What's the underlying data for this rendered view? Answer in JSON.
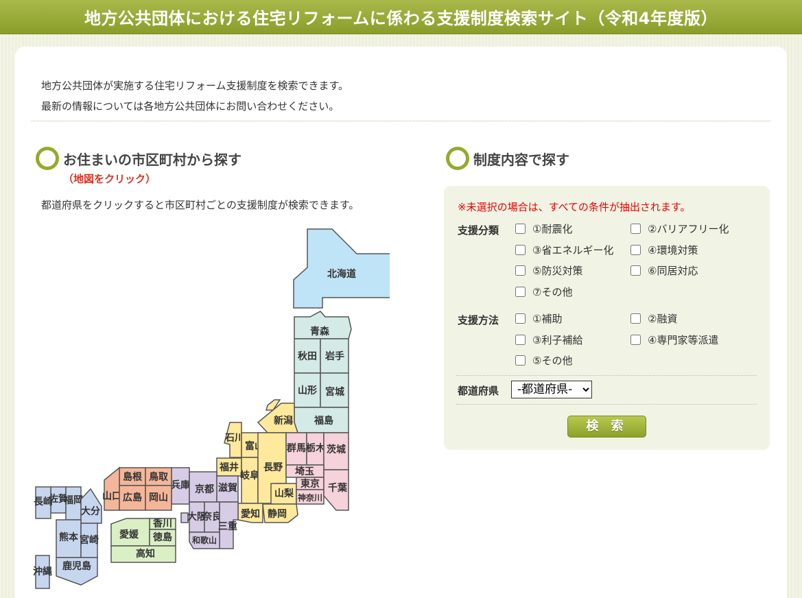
{
  "header": {
    "title": "地方公共団体における住宅リフォームに係わる支援制度検索サイト（令和4年度版）"
  },
  "intro": {
    "line1": "地方公共団体が実施する住宅リフォーム支援制度を検索できます。",
    "line2": "最新の情報については各地方公共団体にお問い合わせください。"
  },
  "map_section": {
    "title": "お住まいの市区町村から探す",
    "subtitle": "（地図をクリック）",
    "description": "都道府県をクリックすると市区町村ごとの支援制度が検索できます。"
  },
  "colors": {
    "hokkaido": "#bfe3f7",
    "tohoku": "#d3eae6",
    "kanto": "#f6d2da",
    "chubu": "#ffe99c",
    "kinki": "#d7cce6",
    "chugoku": "#f4b699",
    "shikoku": "#dbefc5",
    "kyushu": "#c7d6ef"
  },
  "prefectures": {
    "hokkaido": "北海道",
    "aomori": "青森",
    "akita": "秋田",
    "iwate": "岩手",
    "yamagata": "山形",
    "miyagi": "宮城",
    "fukushima": "福島",
    "niigata": "新潟",
    "ishikawa": "石川",
    "toyama": "富山",
    "gunma": "群馬",
    "tochigi": "栃木",
    "ibaraki": "茨城",
    "fukui": "福井",
    "gifu": "岐阜",
    "nagano": "長野",
    "saitama": "埼玉",
    "chiba": "千葉",
    "yamanashi": "山梨",
    "tokyo": "東京",
    "kanagawa": "神奈川",
    "shizuoka": "静岡",
    "aichi": "愛知",
    "shiga": "滋賀",
    "kyoto": "京都",
    "mie": "三重",
    "osaka": "大阪",
    "nara": "奈良",
    "wakayama": "和歌山",
    "hyogo": "兵庫",
    "shimane": "島根",
    "tottori": "鳥取",
    "yamaguchi": "山口",
    "hiroshima": "広島",
    "okayama": "岡山",
    "kagawa": "香川",
    "ehime": "愛媛",
    "tokushima": "徳島",
    "kochi": "高知",
    "fukuoka": "福岡",
    "saga": "佐賀",
    "nagasaki": "長崎",
    "oita": "大分",
    "kumamoto": "熊本",
    "miyazaki": "宮崎",
    "kagoshima": "鹿児島",
    "okinawa": "沖縄"
  },
  "search_section": {
    "title": "制度内容で探す",
    "notice": "※未選択の場合は、すべての条件が抽出されます。",
    "category_label": "支援分類",
    "categories": [
      "①耐震化",
      "②バリアフリー化",
      "③省エネルギー化",
      "④環境対策",
      "⑤防災対策",
      "⑥同居対応",
      "⑦その他"
    ],
    "method_label": "支援方法",
    "methods": [
      "①補助",
      "②融資",
      "③利子補給",
      "④専門家等派遣",
      "⑤その他"
    ],
    "pref_label": "都道府県",
    "pref_selected": "-都道府県-",
    "search_button": "検 索"
  }
}
